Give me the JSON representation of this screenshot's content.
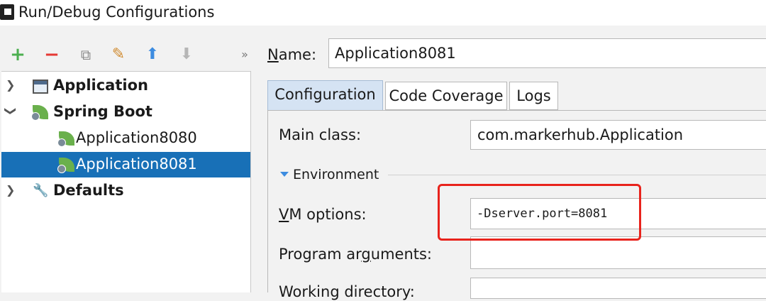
{
  "window": {
    "title": "Run/Debug Configurations"
  },
  "toolbar": {
    "add": "+",
    "remove": "−",
    "copy": "⧉",
    "settings": "✎",
    "move_up": "⬆",
    "move_down": "⬇",
    "more": "»"
  },
  "tree": {
    "items": [
      {
        "label": "Application",
        "icon": "application-icon",
        "expanded": false
      },
      {
        "label": "Spring Boot",
        "icon": "spring-boot-icon",
        "expanded": true
      },
      {
        "label": "Application8080",
        "icon": "spring-boot-icon",
        "selected": false
      },
      {
        "label": "Application8081",
        "icon": "spring-boot-icon",
        "selected": true
      },
      {
        "label": "Defaults",
        "icon": "wrench-icon",
        "expanded": false
      }
    ]
  },
  "name": {
    "label_first": "N",
    "label_rest": "ame:",
    "value": "Application8081"
  },
  "tabs": [
    {
      "label": "Configuration",
      "active": true
    },
    {
      "label": "Code Coverage",
      "active": false
    },
    {
      "label": "Logs",
      "active": false
    }
  ],
  "form": {
    "main_class": {
      "label": "Main class:",
      "value": "com.markerhub.Application"
    },
    "environment": {
      "label": "Environment"
    },
    "vm_options": {
      "label_first": "V",
      "label_rest": "M options:",
      "value": "-Dserver.port=8081"
    },
    "program_arguments": {
      "label_before": "Program ar",
      "label_underlined": "g",
      "label_after": "uments:",
      "value": ""
    },
    "working_directory": {
      "label": "Working directory:",
      "value": ""
    }
  },
  "colors": {
    "selection": "#1870b7",
    "highlight": "#e8231c",
    "accent": "#3d8ce0",
    "spring_green": "#6ab04c"
  }
}
